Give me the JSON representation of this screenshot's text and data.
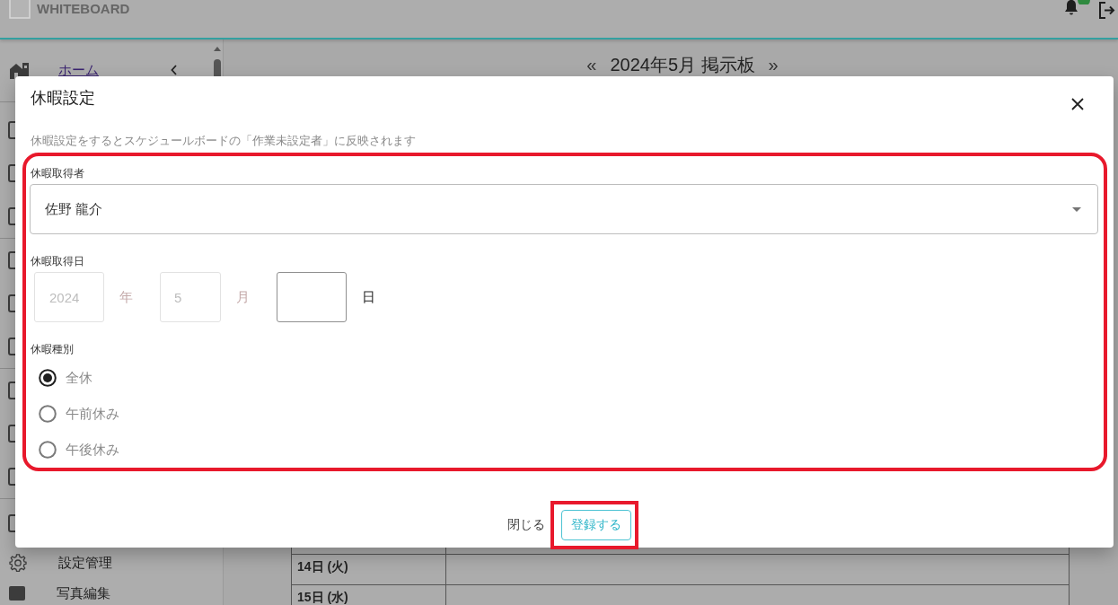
{
  "app_bar": {
    "title": "WHITEBOARD",
    "notification_badge": true
  },
  "sidebar": {
    "header_item": {
      "label": "ホーム",
      "kind": "link"
    },
    "footer_items": [
      {
        "label": "設定管理",
        "kind": "item"
      },
      {
        "label": "写真編集",
        "kind": "item"
      }
    ]
  },
  "board": {
    "prev": "«",
    "title": "2024年5月 掲示板",
    "next": "»",
    "rows": [
      {
        "date": "14日 (火)"
      },
      {
        "date": "15日 (水)"
      }
    ]
  },
  "dialog": {
    "title": "休暇設定",
    "note": "休暇設定をするとスケジュールボードの「作業未設定者」に反映されます",
    "highlighted": true,
    "person": {
      "label": "休暇取得者",
      "value": "佐野 龍介"
    },
    "date": {
      "label": "休暇取得日",
      "parts": [
        {
          "value": "2024",
          "unit": "年",
          "disabled": true
        },
        {
          "value": "5",
          "unit": "月",
          "disabled": true
        },
        {
          "unit": "日",
          "disabled": false
        }
      ]
    },
    "leave_type": {
      "label": "休暇種別",
      "options": [
        {
          "label": "全休",
          "selected": true
        },
        {
          "label": "午前休み",
          "selected": false
        },
        {
          "label": "午後休み",
          "selected": false
        }
      ]
    },
    "buttons": [
      {
        "label": "閉じる",
        "kind": "text",
        "highlighted": false
      },
      {
        "label": "登録する",
        "kind": "outlined",
        "highlighted": true
      }
    ]
  }
}
